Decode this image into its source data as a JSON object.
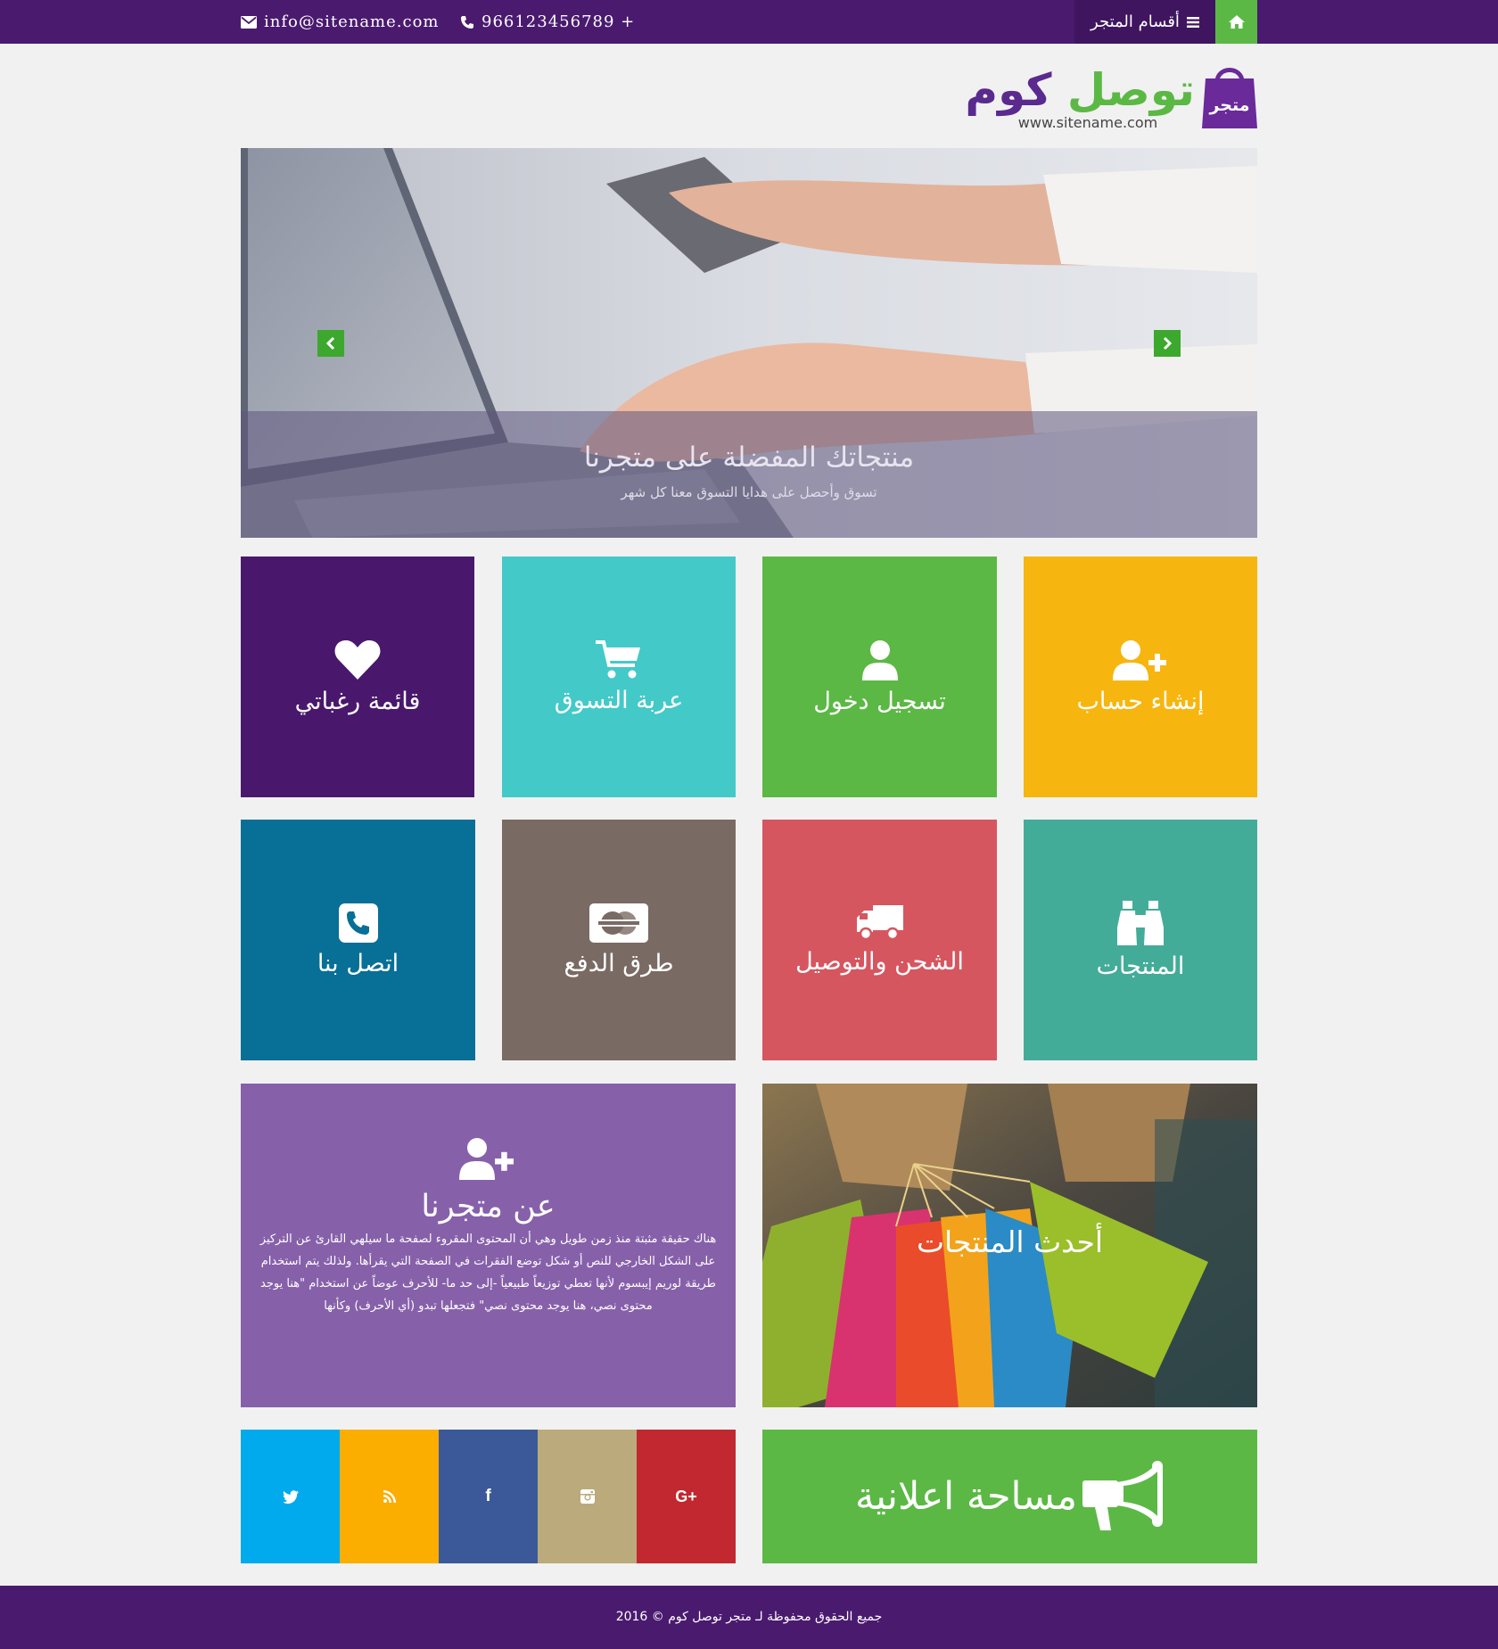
{
  "topbar": {
    "email": "info@sitename.com",
    "phone": "966123456789 +",
    "categories_label": "أقسام المتجر"
  },
  "logo": {
    "name_green": "توصل",
    "name_purple": "كوم",
    "bag_label": "متجر",
    "url": "www.sitename.com"
  },
  "slider": {
    "title": "منتجاتك المفضلة على متجرنا",
    "subtitle": "تسوق وأحصل على هدايا التسوق معنا كل شهر"
  },
  "tiles": {
    "wishlist": "قائمة رغباتي",
    "cart": "عربة التسوق",
    "login": "تسجيل دخول",
    "register": "إنشاء حساب",
    "contact": "اتصل بنا",
    "payment": "طرق الدفع",
    "shipping": "الشحن والتوصيل",
    "products": "المنتجات"
  },
  "about": {
    "title": "عن متجرنا",
    "text": "هناك حقيقة مثبتة منذ زمن طويل وهي أن المحتوى المقروء لصفحة ما سيلهي القارئ عن التركيز على الشكل الخارجي للنص أو شكل توضع الفقرات في الصفحة التي يقرأها. ولذلك يتم استخدام طريقة لوريم إيبسوم لأنها تعطي توزيعاً طبيعياً -إلى حد ما- للأحرف عوضاً عن استخدام \"هنا يوجد محتوى نصي، هنا يوجد محتوى نصي\" فتجعلها تبدو (أي الأحرف) وكأنها"
  },
  "latest": {
    "label": "أحدث المنتجات"
  },
  "social": {
    "twitter": "twitter-icon",
    "rss": "rss-icon",
    "facebook": "f",
    "instagram": "instagram-icon",
    "googleplus": "G+"
  },
  "ad": {
    "label": "مساحة اعلانية"
  },
  "footer": {
    "copyright": "جميع الحقوق محفوظة لـ متجر توصل كوم © 2016"
  },
  "colors": {
    "brand_purple": "#4a1a6f",
    "brand_green": "#5cb845",
    "wishlist": "#49186c",
    "cart": "#44c9c9",
    "login": "#5cb845",
    "register": "#f7b50f",
    "contact": "#086f97",
    "payment": "#7a6a64",
    "shipping": "#d6565f",
    "products": "#43ac99",
    "about": "#8760aa",
    "twitter": "#00aaec",
    "rss": "#fbad00",
    "facebook": "#3b5998",
    "instagram": "#bbab7c",
    "googleplus": "#c1282f"
  }
}
